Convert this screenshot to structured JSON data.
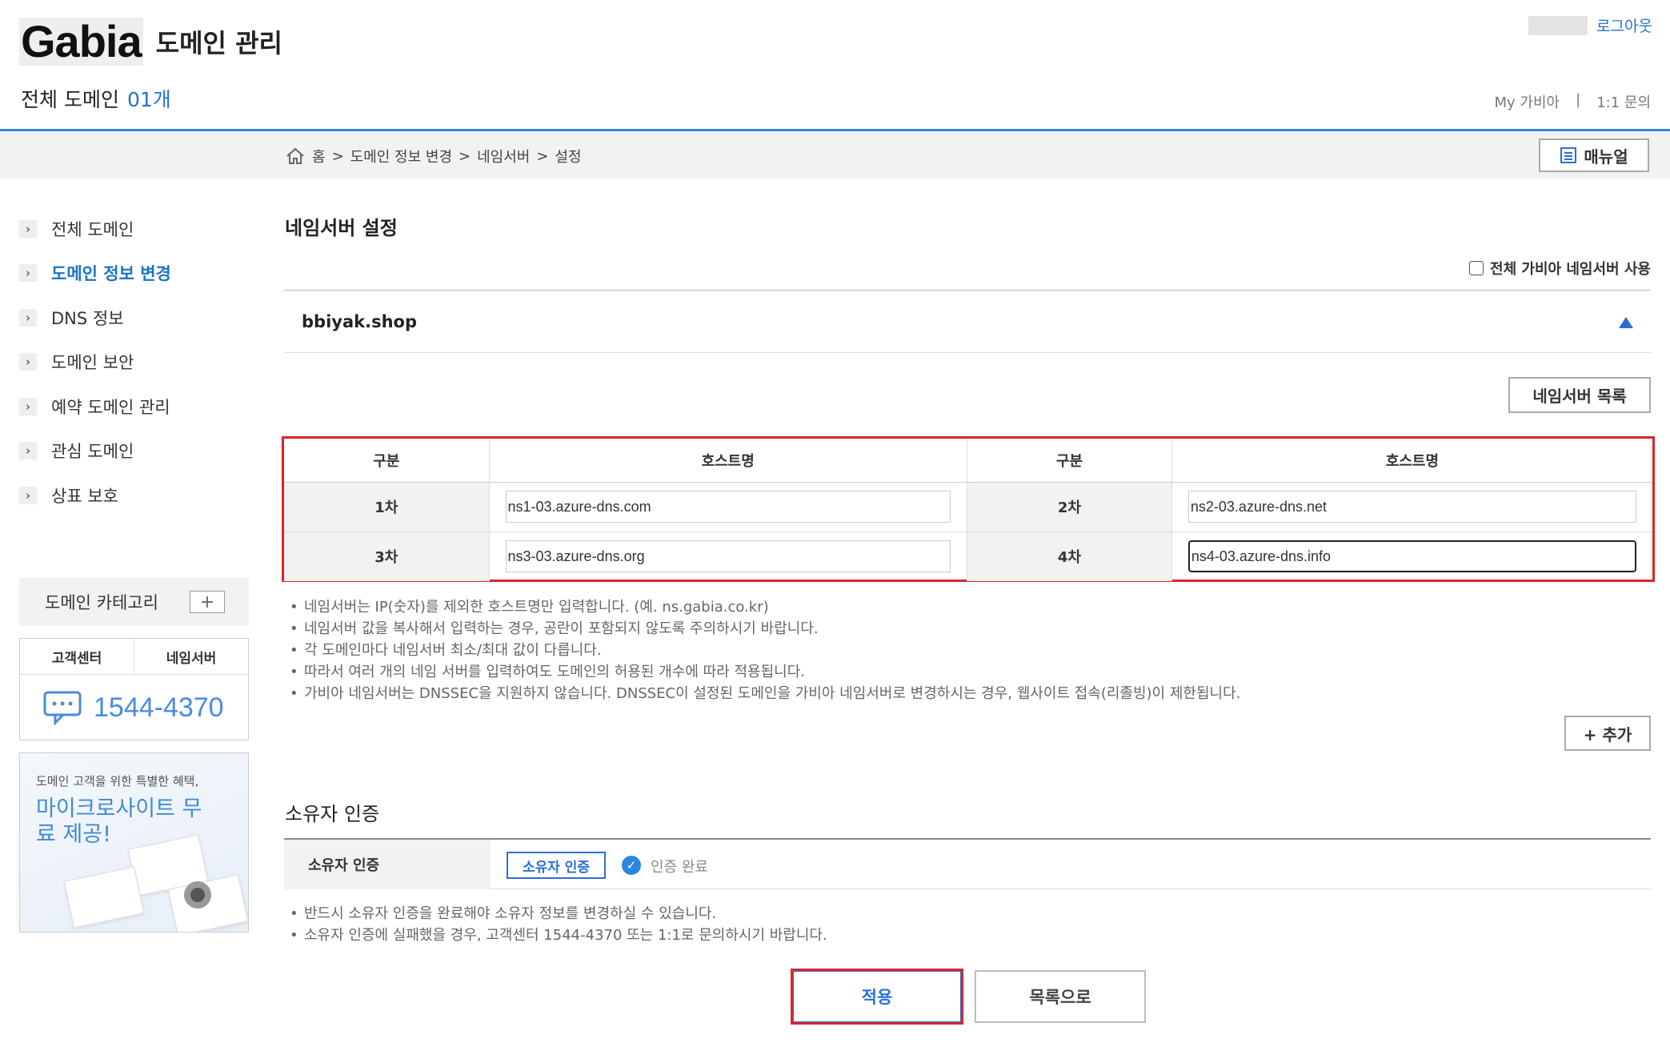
{
  "header": {
    "logo_text": "Gabia",
    "app_title": "도메인 관리",
    "logout": "로그아웃",
    "all_domains_label": "전체 도메인",
    "all_domains_count": "01개",
    "links": [
      "My 가비아",
      "|",
      "1:1 문의"
    ]
  },
  "breadcrumb": [
    "홈",
    ">",
    "도메인 정보 변경",
    ">",
    "네임서버",
    ">",
    "설정"
  ],
  "manual_label": "매뉴얼",
  "sidebar": {
    "items": [
      {
        "label": "전체 도메인",
        "active": false
      },
      {
        "label": "도메인 정보 변경",
        "active": true
      },
      {
        "label": "DNS 정보",
        "active": false
      },
      {
        "label": "도메인 보안",
        "active": false
      },
      {
        "label": "예약 도메인 관리",
        "active": false
      },
      {
        "label": "관심 도메인",
        "active": false
      },
      {
        "label": "상표 보호",
        "active": false
      }
    ],
    "category_label": "도메인 카테고리",
    "category_add": "+",
    "cs_tabs": [
      "고객센터",
      "네임서버"
    ],
    "cs_phone": "1544-4370",
    "promo_sub": "도메인 고객을 위한 특별한 혜택,",
    "promo_title": "마이크로사이트 무료 제공!"
  },
  "main": {
    "title": "네임서버 설정",
    "all_ns_checkbox": "전체 가비아 네임서버 사용",
    "domain": "bbiyak.shop",
    "ns_list_button": "네임서버 목록",
    "table": {
      "headers": [
        "구분",
        "호스트명",
        "구분",
        "호스트명"
      ],
      "rows": [
        [
          {
            "label": "1차",
            "value": "ns1-03.azure-dns.com"
          },
          {
            "label": "2차",
            "value": "ns2-03.azure-dns.net"
          }
        ],
        [
          {
            "label": "3차",
            "value": "ns3-03.azure-dns.org"
          },
          {
            "label": "4차",
            "value": "ns4-03.azure-dns.info"
          }
        ]
      ]
    },
    "notes": [
      "네임서버는 IP(숫자)를 제외한 호스트명만 입력합니다. (예. ns.gabia.co.kr)",
      "네임서버 값을 복사해서 입력하는 경우, 공란이 포함되지 않도록 주의하시기 바랍니다.",
      "각 도메인마다 네임서버 최소/최대 값이 다릅니다.",
      "따라서 여러 개의 네임 서버를 입력하여도 도메인의 허용된 개수에 따라 적용됩니다.",
      "가비아 네임서버는 DNSSEC을 지원하지 않습니다. DNSSEC이 설정된 도메인을 가비아 네임서버로 변경하시는 경우, 웹사이트 접속(리졸빙)이 제한됩니다."
    ],
    "add_button": "+ 추가",
    "owner": {
      "section_title": "소유자 인증",
      "row_label": "소유자 인증",
      "verify_button": "소유자 인증",
      "status": "인증 완료",
      "notes": [
        "반드시 소유자 인증을 완료해야 소유자 정보를 변경하실 수 있습니다.",
        "소유자 인증에 실패했을 경우, 고객센터 1544-4370 또는 1:1로 문의하시기 바랍니다."
      ]
    },
    "apply_button": "적용",
    "list_button": "목록으로"
  },
  "colors": {
    "accent": "#2a6fd6",
    "highlight_border": "#d9262c",
    "header_rule": "#3a86d4"
  }
}
